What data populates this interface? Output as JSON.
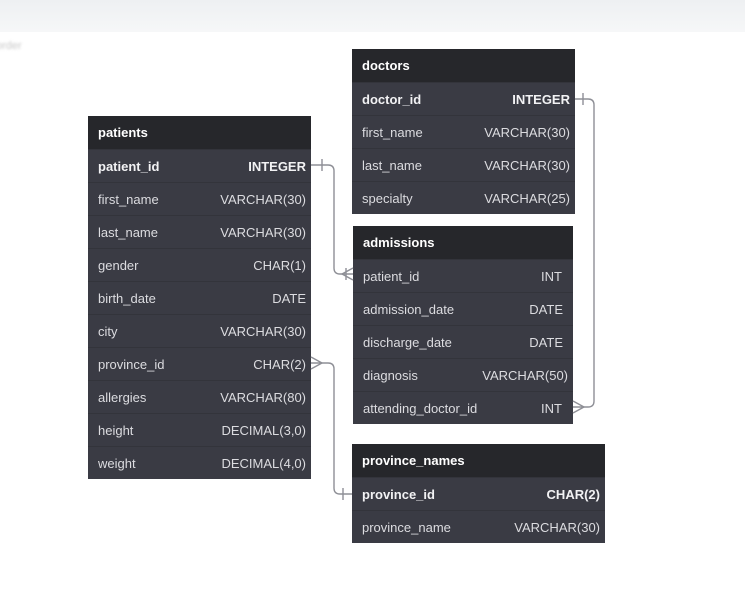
{
  "corner_text": "order",
  "tables": {
    "patients": {
      "name": "patients",
      "columns": [
        {
          "name": "patient_id",
          "type": "INTEGER",
          "pk": true
        },
        {
          "name": "first_name",
          "type": "VARCHAR(30)"
        },
        {
          "name": "last_name",
          "type": "VARCHAR(30)"
        },
        {
          "name": "gender",
          "type": "CHAR(1)"
        },
        {
          "name": "birth_date",
          "type": "DATE"
        },
        {
          "name": "city",
          "type": "VARCHAR(30)"
        },
        {
          "name": "province_id",
          "type": "CHAR(2)"
        },
        {
          "name": "allergies",
          "type": "VARCHAR(80)"
        },
        {
          "name": "height",
          "type": "DECIMAL(3,0)"
        },
        {
          "name": "weight",
          "type": "DECIMAL(4,0)"
        }
      ]
    },
    "doctors": {
      "name": "doctors",
      "columns": [
        {
          "name": "doctor_id",
          "type": "INTEGER",
          "pk": true
        },
        {
          "name": "first_name",
          "type": "VARCHAR(30)"
        },
        {
          "name": "last_name",
          "type": "VARCHAR(30)"
        },
        {
          "name": "specialty",
          "type": "VARCHAR(25)"
        }
      ]
    },
    "admissions": {
      "name": "admissions",
      "columns": [
        {
          "name": "patient_id",
          "type": "INT"
        },
        {
          "name": "admission_date",
          "type": "DATE"
        },
        {
          "name": "discharge_date",
          "type": "DATE"
        },
        {
          "name": "diagnosis",
          "type": "VARCHAR(50)"
        },
        {
          "name": "attending_doctor_id",
          "type": "INT"
        }
      ]
    },
    "province_names": {
      "name": "province_names",
      "columns": [
        {
          "name": "province_id",
          "type": "CHAR(2)",
          "pk": true
        },
        {
          "name": "province_name",
          "type": "VARCHAR(30)"
        }
      ]
    }
  },
  "relationships": [
    {
      "from": "patients.patient_id",
      "to": "admissions.patient_id",
      "type": "one-to-many"
    },
    {
      "from": "doctors.doctor_id",
      "to": "admissions.attending_doctor_id",
      "type": "one-to-many"
    },
    {
      "from": "province_names.province_id",
      "to": "patients.province_id",
      "type": "one-to-many"
    }
  ]
}
